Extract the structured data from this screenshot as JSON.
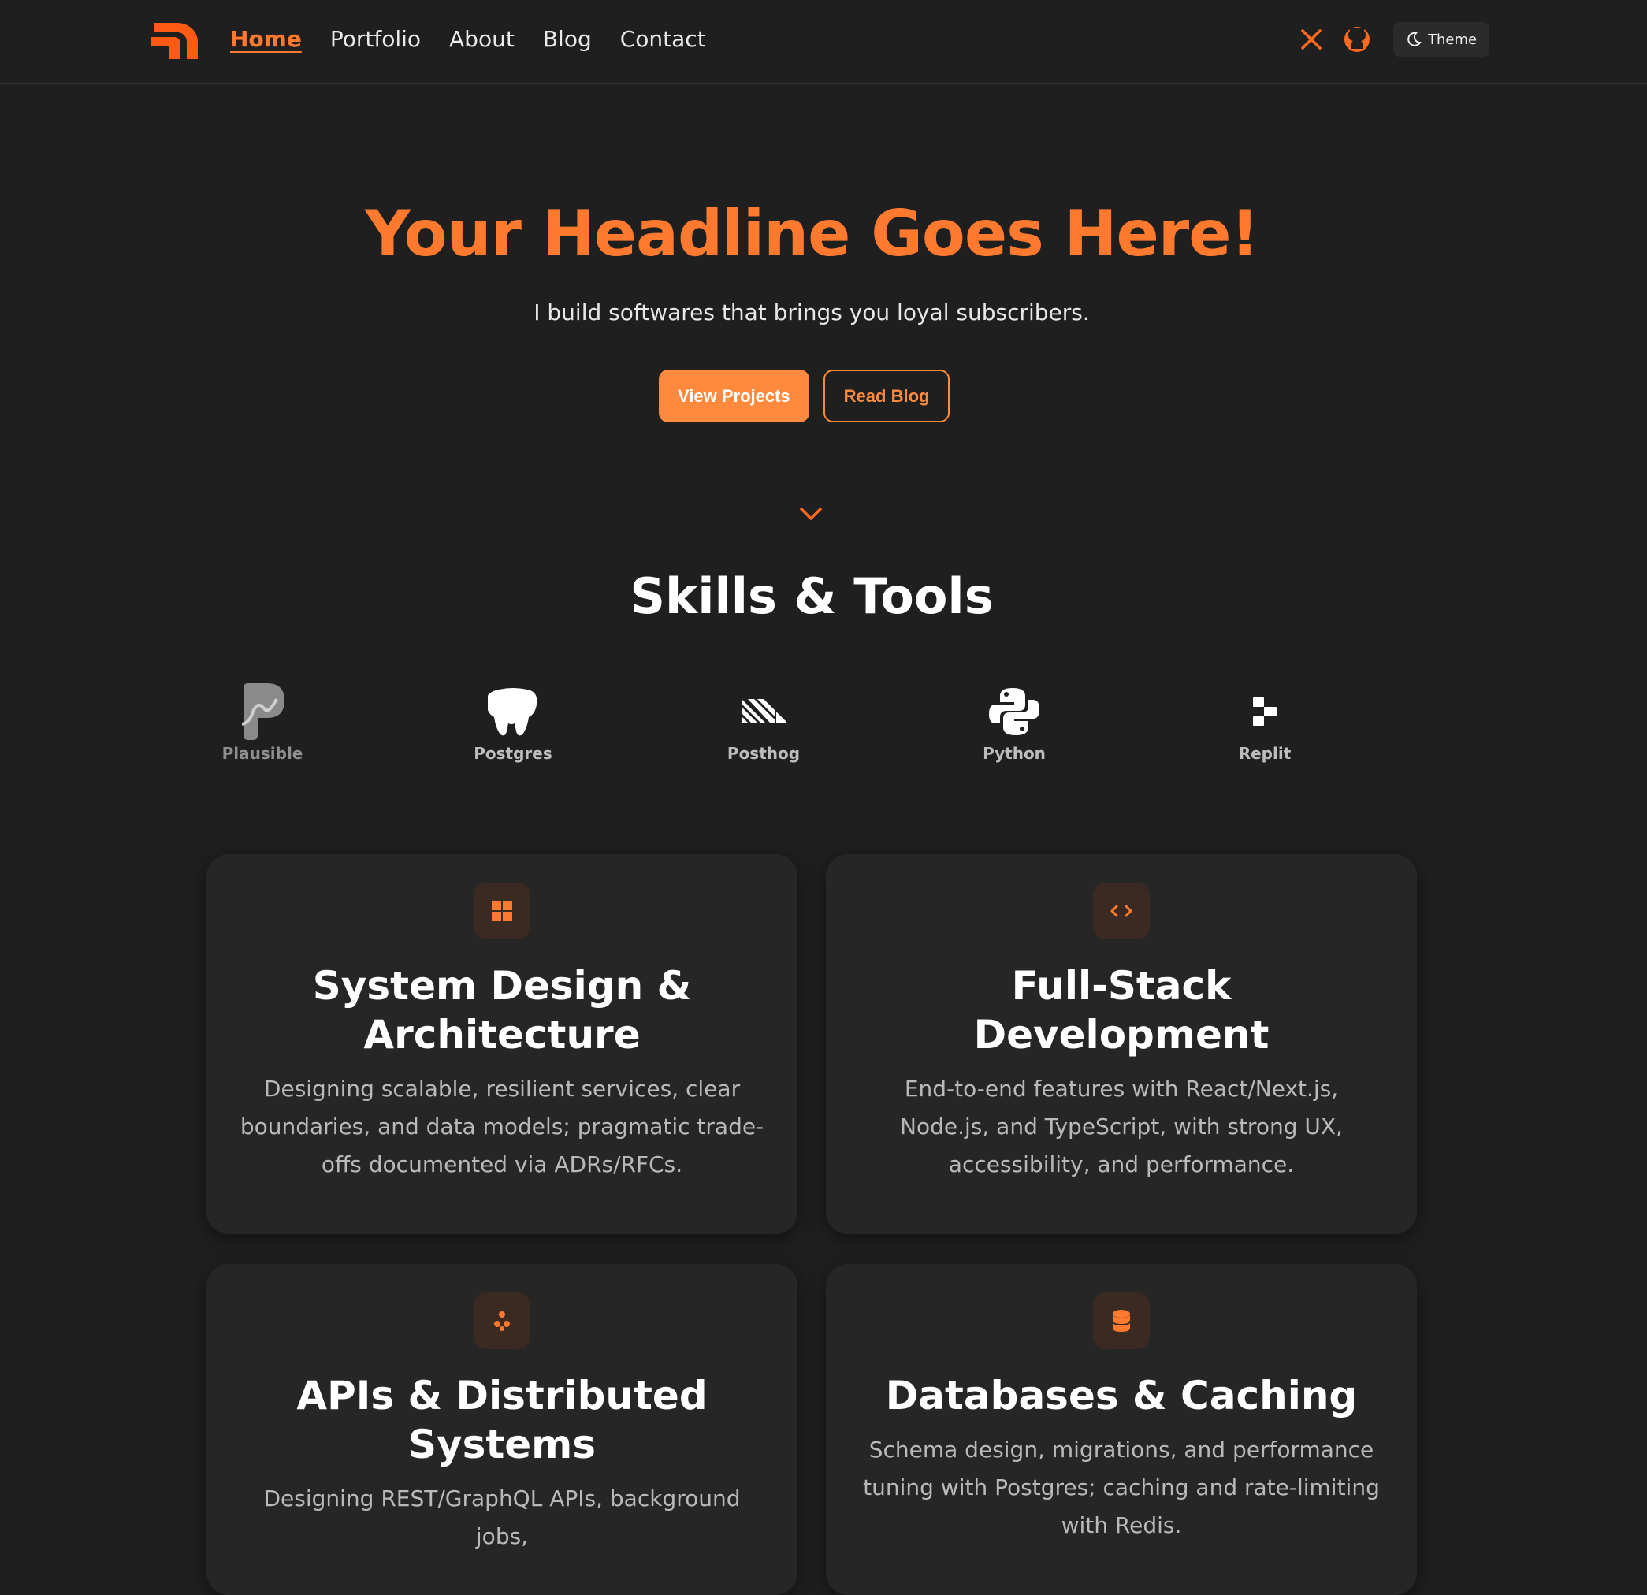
{
  "nav": {
    "items": [
      {
        "label": "Home",
        "active": true
      },
      {
        "label": "Portfolio"
      },
      {
        "label": "About"
      },
      {
        "label": "Blog"
      },
      {
        "label": "Contact"
      }
    ],
    "theme_label": "Theme"
  },
  "hero": {
    "title": "Your Headline Goes Here!",
    "subtitle": "I build softwares that brings you loyal subscribers.",
    "primary_btn": "View Projects",
    "secondary_btn": "Read Blog"
  },
  "skills": {
    "title": "Skills & Tools",
    "tools": [
      "Plausible",
      "Postgres",
      "Posthog",
      "Python",
      "Replit"
    ]
  },
  "cards": [
    {
      "title": "System Design & Architecture",
      "desc": "Designing scalable, resilient services, clear boundaries, and data models; pragmatic trade-offs documented via ADRs/RFCs.",
      "icon": "grid-icon"
    },
    {
      "title": "Full-Stack Development",
      "desc": "End-to-end features with React/Next.js, Node.js, and TypeScript, with strong UX, accessibility, and performance.",
      "icon": "code-icon"
    },
    {
      "title": "APIs & Distributed Systems",
      "desc": "Designing REST/GraphQL APIs, background jobs,",
      "icon": "network-icon"
    },
    {
      "title": "Databases & Caching",
      "desc": "Schema design, migrations, and performance tuning with Postgres; caching and rate-limiting with Redis.",
      "icon": "database-icon"
    }
  ],
  "colors": {
    "accent": "#ff7a2f",
    "background": "#1f1f1f",
    "card": "#262626"
  }
}
